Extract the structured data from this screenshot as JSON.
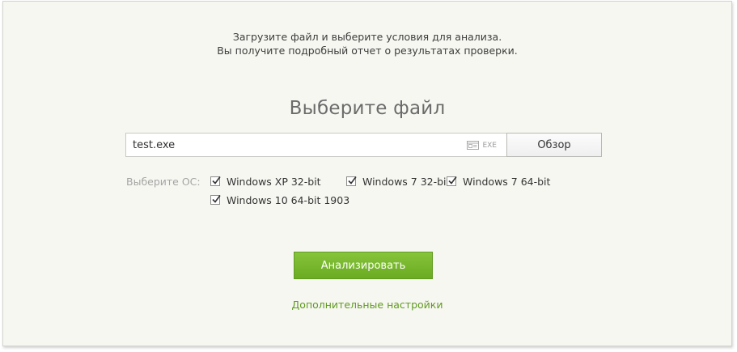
{
  "intro": {
    "line1": "Загрузите файл и выберите условия для анализа.",
    "line2": "Вы получите подробный отчет о результатах проверки."
  },
  "upload": {
    "title": "Выберите файл",
    "file_name": "test.exe",
    "file_ext": "EXE",
    "browse_label": "Обзор"
  },
  "os": {
    "label": "Выберите ОС:",
    "options": [
      {
        "label": "Windows XP 32-bit",
        "checked": true
      },
      {
        "label": "Windows 7 32-bit",
        "checked": true
      },
      {
        "label": "Windows 7 64-bit",
        "checked": true
      },
      {
        "label": "Windows 10 64-bit 1903",
        "checked": true
      }
    ]
  },
  "actions": {
    "analyze_label": "Анализировать",
    "advanced_label": "Дополнительные настройки"
  },
  "colors": {
    "accent": "#6aab22",
    "link": "#5f9a1f",
    "panel_bg": "#f7f7f2"
  },
  "icons": {
    "file_type": "window-file-icon",
    "checkbox_mark": "checkmark-icon"
  }
}
